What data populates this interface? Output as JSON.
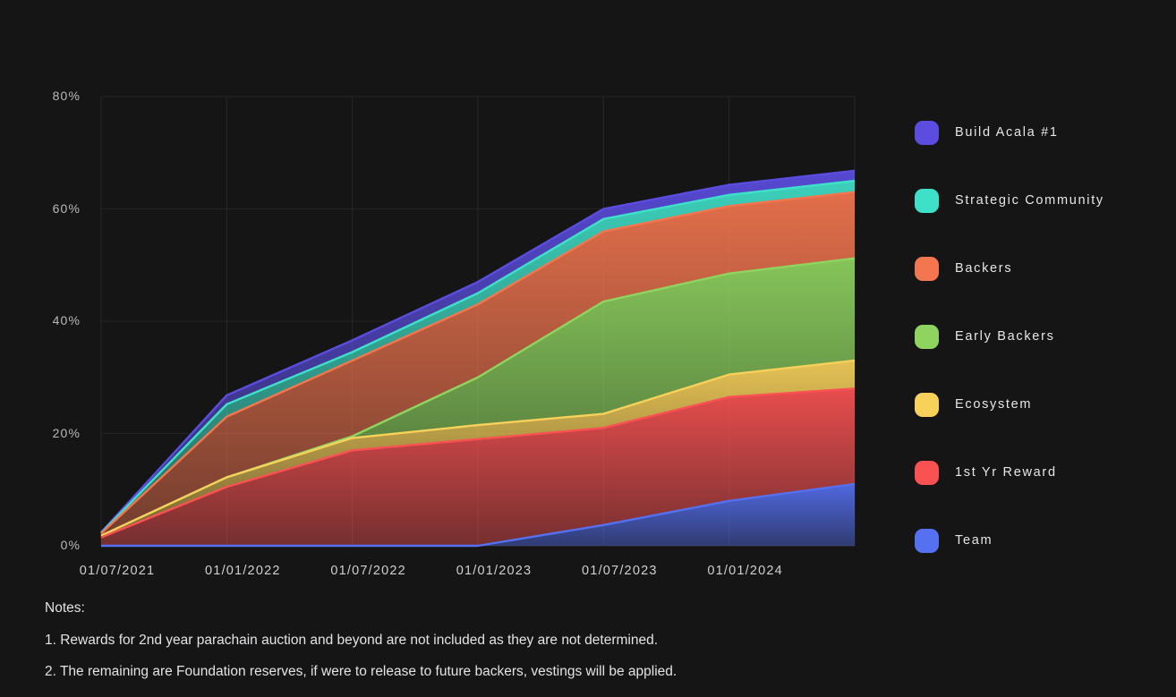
{
  "chart_data": {
    "type": "area",
    "stacked": true,
    "title": "",
    "xlabel": "",
    "ylabel": "",
    "grid": true,
    "legend_position": "right",
    "ylim": [
      0,
      80
    ],
    "ytick_labels": [
      "80%",
      "60%",
      "40%",
      "20%",
      "0%"
    ],
    "ytick_values": [
      80,
      60,
      40,
      20,
      0
    ],
    "xtick_labels": [
      "01/07/2021",
      "01/01/2022",
      "01/07/2022",
      "01/01/2023",
      "01/07/2023",
      "01/01/2024"
    ],
    "x": [
      "01/07/2021",
      "01/01/2022",
      "01/07/2022",
      "01/01/2023",
      "01/07/2023",
      "01/01/2024",
      "01/07/2024"
    ],
    "series": [
      {
        "name": "Team",
        "color": "#5570f0",
        "values": [
          0,
          0,
          0,
          0,
          3.7,
          8.0,
          11.0
        ]
      },
      {
        "name": "1st Yr Reward",
        "color": "#fa5252",
        "values": [
          1.5,
          10.5,
          17.0,
          19.0,
          17.3,
          18.5,
          17.0
        ]
      },
      {
        "name": "Ecosystem",
        "color": "#f7d15a",
        "values": [
          0.3,
          1.7,
          2.2,
          2.5,
          2.5,
          4.0,
          5.0
        ]
      },
      {
        "name": "Early Backers",
        "color": "#8fd45f",
        "values": [
          0,
          0,
          0.3,
          8.5,
          20.0,
          18.0,
          18.2
        ]
      },
      {
        "name": "Backers",
        "color": "#f4764f",
        "values": [
          0.4,
          10.8,
          13.5,
          13.0,
          12.5,
          12.0,
          11.8
        ]
      },
      {
        "name": "Strategic Community",
        "color": "#3fe0c8",
        "values": [
          0.1,
          2.2,
          1.5,
          2.0,
          2.2,
          2.0,
          2.0
        ]
      },
      {
        "name": "Build Acala #1",
        "color": "#5b4de0",
        "values": [
          0.1,
          1.6,
          2.1,
          2.0,
          1.8,
          1.8,
          1.8
        ]
      }
    ],
    "cumulative_tops": {
      "Team": [
        0,
        0,
        0,
        0,
        3.7,
        8.0,
        11.0
      ],
      "1st Yr Reward": [
        1.5,
        10.5,
        17.0,
        19.0,
        21.0,
        26.5,
        28.0
      ],
      "Ecosystem": [
        1.8,
        12.2,
        19.2,
        21.5,
        23.5,
        30.5,
        33.0
      ],
      "Early Backers": [
        1.8,
        12.2,
        19.5,
        30.0,
        43.5,
        48.5,
        51.2
      ],
      "Backers": [
        2.2,
        23.0,
        33.0,
        43.0,
        56.0,
        60.5,
        63.0
      ],
      "Strategic Community": [
        2.3,
        25.2,
        34.5,
        45.0,
        58.2,
        62.5,
        65.0
      ],
      "Build Acala #1": [
        2.4,
        26.8,
        36.6,
        47.0,
        60.0,
        64.3,
        66.8
      ]
    }
  },
  "legend": {
    "items": [
      {
        "label": "Build Acala #1",
        "color": "#5b4de0"
      },
      {
        "label": "Strategic Community",
        "color": "#3fe0c8"
      },
      {
        "label": "Backers",
        "color": "#f4764f"
      },
      {
        "label": "Early Backers",
        "color": "#8fd45f"
      },
      {
        "label": "Ecosystem",
        "color": "#f7d15a"
      },
      {
        "label": "1st Yr Reward",
        "color": "#fa5252"
      },
      {
        "label": "Team",
        "color": "#5570f0"
      }
    ]
  },
  "notes": {
    "heading": "Notes:",
    "lines": [
      "1. Rewards for 2nd year parachain auction and beyond are not included as they are not determined.",
      "2. The remaining are Foundation reserves, if were to release to future backers, vestings will be applied."
    ]
  },
  "colors": {
    "background": "#151516",
    "grid": "#2f2f31",
    "axis_text": "#b9b9bb",
    "note_text": "#e3e3e5"
  }
}
